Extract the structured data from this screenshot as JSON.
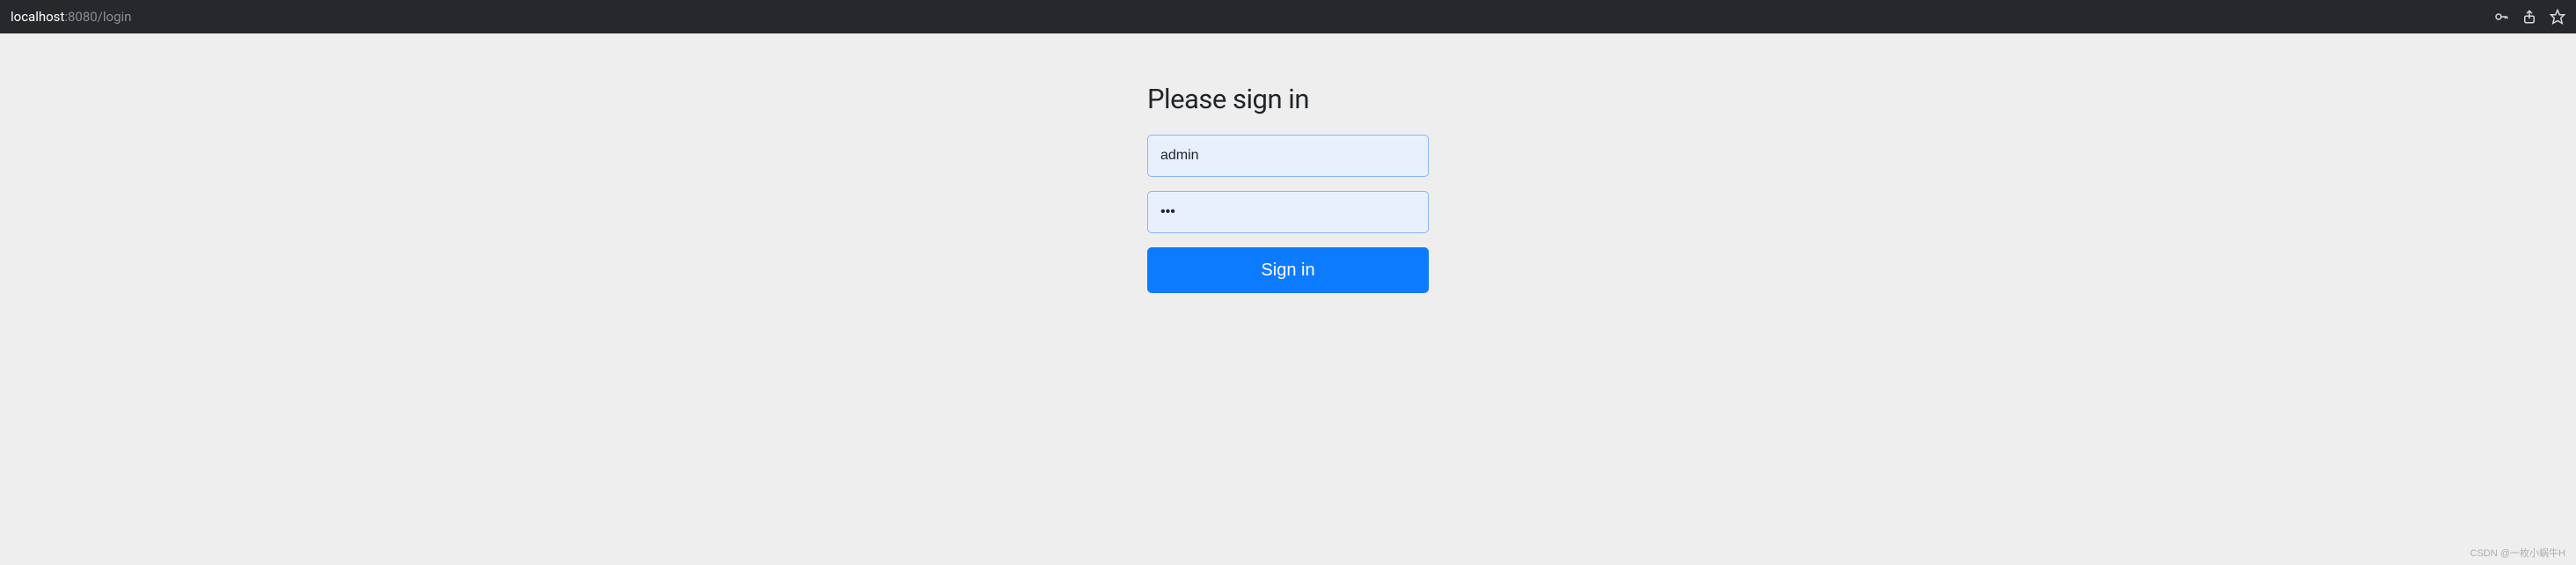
{
  "address_bar": {
    "url_host": "localhost",
    "url_port_path": ":8080/login"
  },
  "form": {
    "heading": "Please sign in",
    "username_value": "admin",
    "password_value": "•••",
    "submit_label": "Sign in"
  },
  "watermark": "CSDN @一枚小蜗牛H"
}
